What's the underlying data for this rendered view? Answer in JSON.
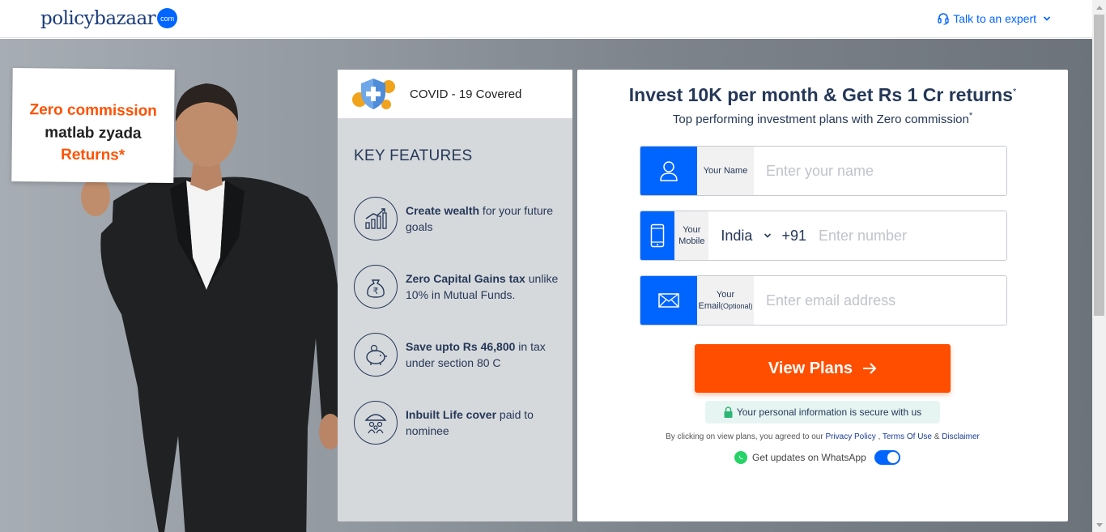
{
  "header": {
    "logo_text_1": "policy",
    "logo_text_2": "bazaar",
    "logo_badge": "com",
    "expert_label": "Talk to an expert"
  },
  "placard": {
    "line1": "Zero commission",
    "line2": "matlab zyada",
    "line3": "Returns*"
  },
  "features": {
    "covid_label": "COVID - 19 Covered",
    "title": "KEY FEATURES",
    "items": [
      {
        "bold": "Create wealth",
        "rest": " for your future goals",
        "icon": "chart-growth-icon"
      },
      {
        "bold": "Zero Capital Gains tax",
        "rest": " unlike 10% in Mutual Funds.",
        "icon": "money-bag-icon"
      },
      {
        "bold": "Save upto Rs 46,800",
        "rest": " in tax under section 80 C",
        "icon": "piggy-bank-icon"
      },
      {
        "bold": "Inbuilt Life cover",
        "rest": " paid to nominee",
        "icon": "family-umbrella-icon"
      }
    ]
  },
  "form": {
    "title": "Invest 10K per month & Get Rs 1 Cr returns",
    "title_sup": "*",
    "subtitle": "Top performing investment plans with Zero commission",
    "subtitle_sup": "*",
    "name_label": "Your Name",
    "name_placeholder": "Enter your name",
    "mobile_label": "Your Mobile",
    "country": "India",
    "country_code": "+91",
    "mobile_placeholder": "Enter number",
    "email_label": "Your Email",
    "email_label_optional": "(Optional)",
    "email_placeholder": "Enter email address",
    "button_label": "View Plans",
    "secure_text": "Your personal information is secure with us",
    "agree_prefix": "By clicking on view plans, you agreed to our ",
    "privacy": "Privacy Policy",
    "sep1": " , ",
    "terms": "Terms Of Use",
    "sep2": " & ",
    "disclaimer": "Disclaimer",
    "whatsapp_text": "Get updates on WhatsApp",
    "whatsapp_enabled": true
  },
  "colors": {
    "brand_blue": "#0065ff",
    "cta_orange": "#ff4e00",
    "navy": "#253858"
  }
}
